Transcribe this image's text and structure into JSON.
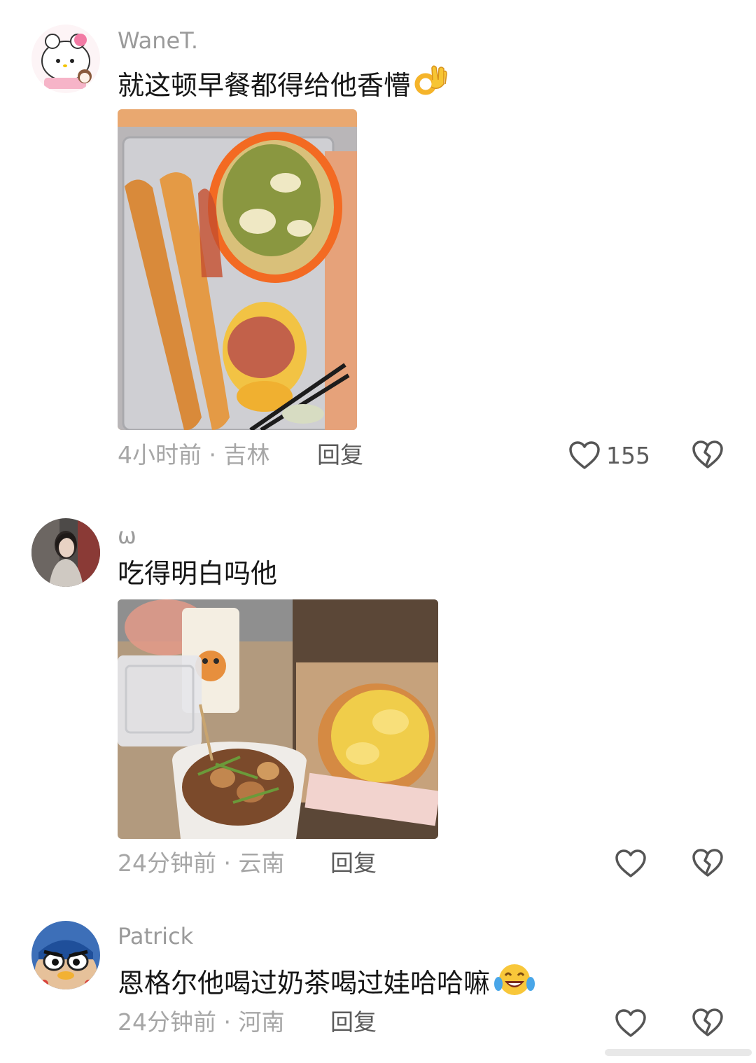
{
  "comments": [
    {
      "username": "WaneT.",
      "text": "就这顿早餐都得给他香懵",
      "emoji": "ok-hand",
      "time": "4小时前",
      "location": "吉林",
      "reply_label": "回复",
      "likes": "155"
    },
    {
      "username": "ω",
      "text": "吃得明白吗他",
      "time": "24分钟前",
      "location": "云南",
      "reply_label": "回复",
      "likes": ""
    },
    {
      "username": "Patrick",
      "text": "恩格尔他喝过奶茶喝过娃哈哈嘛",
      "emoji": "laughing-tears",
      "time": "24分钟前",
      "location": "河南",
      "reply_label": "回复",
      "likes": ""
    }
  ],
  "separator": " · ",
  "colors": {
    "username": "#9a9a9a",
    "text": "#161616",
    "meta": "#a6a6a6",
    "action": "#5a5a5a"
  },
  "icons": {
    "like": "heart-outline-icon",
    "dislike": "broken-heart-icon"
  }
}
